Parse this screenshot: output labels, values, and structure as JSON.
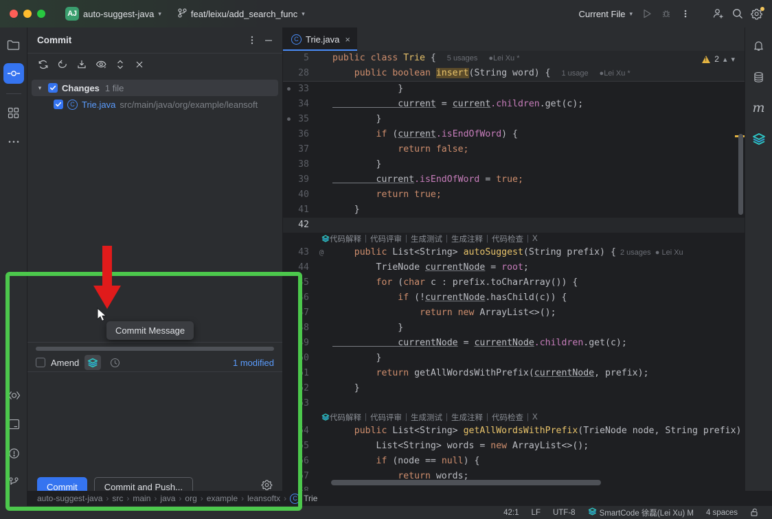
{
  "titlebar": {
    "project_badge": "AJ",
    "project_name": "auto-suggest-java",
    "branch": "feat/leixu/add_search_func",
    "run_config": "Current File",
    "icons": [
      "run-icon",
      "debug-icon",
      "more-actions-icon",
      "add-collaborator-icon",
      "search-everywhere-icon",
      "settings-icon"
    ]
  },
  "left_toolbar": {
    "items": [
      {
        "name": "project-tool-window",
        "icon": "folder-icon"
      },
      {
        "name": "commit-tool-window",
        "icon": "commit-icon",
        "active": true
      },
      {
        "name": "structure-tool-window",
        "icon": "structure-icon"
      },
      {
        "name": "more-tool-windows",
        "icon": "ellipsis-icon"
      }
    ],
    "bottom_items": [
      {
        "name": "code-with-me",
        "icon": "code-with-me-icon"
      },
      {
        "name": "terminal-tool-window",
        "icon": "terminal-icon"
      },
      {
        "name": "problems-tool-window",
        "icon": "problems-icon"
      },
      {
        "name": "version-control-tool-window",
        "icon": "git-branch-icon"
      }
    ]
  },
  "right_toolbar": {
    "items": [
      {
        "name": "notifications",
        "icon": "bell-icon"
      },
      {
        "name": "database-tool-window",
        "icon": "database-icon"
      },
      {
        "name": "maven-tool-window",
        "icon": "maven-m-icon"
      },
      {
        "name": "smartcode-tool-window",
        "icon": "smartcode-stack-icon"
      }
    ]
  },
  "commit_panel": {
    "title": "Commit",
    "header_icons": [
      "more-options-icon",
      "minimize-icon"
    ],
    "toolbar_icons": [
      "refresh-icon",
      "rollback-icon",
      "shelve-icon",
      "preview-diff-icon",
      "expand-collapse-icon",
      "close-icon"
    ],
    "changes": {
      "group_label": "Changes",
      "group_count": "1 file",
      "files": [
        {
          "name": "Trie.java",
          "path": "src/main/java/org/example/leansoft",
          "checked": true
        }
      ]
    },
    "amend_label": "Amend",
    "amend_checked": false,
    "modified_label": "1 modified",
    "message_value": "",
    "message_placeholder": "",
    "commit_button": "Commit",
    "commit_push_button": "Commit and Push...",
    "settings_icon": "gear-icon",
    "message_toolbar_icons": [
      "smartcode-commit-message-icon",
      "commit-history-icon"
    ],
    "tooltip": "Commit Message"
  },
  "editor": {
    "tab": {
      "label": "Trie.java",
      "icon": "java-class-icon",
      "close": "×"
    },
    "warnings": {
      "count": "2",
      "icon": "warning-icon"
    },
    "sticky_lines": [
      {
        "num": "5",
        "segments": [
          {
            "t": "kw",
            "s": "public "
          },
          {
            "t": "kw",
            "s": "class "
          },
          {
            "t": "fnd",
            "s": "Trie"
          },
          {
            "t": "pl",
            "s": " {"
          }
        ],
        "usages": "5 usages",
        "author": "Lei Xu *"
      },
      {
        "num": "28",
        "segments": [
          {
            "t": "kw",
            "s": "    public "
          },
          {
            "t": "kw",
            "s": "boolean "
          },
          {
            "t": "hl",
            "s": "insert"
          },
          {
            "t": "pl",
            "s": "(String word) {"
          }
        ],
        "usages": "1 usage",
        "author": "Lei Xu *"
      }
    ],
    "ai_hints": [
      "代码解释",
      "代码评审",
      "生成测试",
      "生成注释",
      "代码检查",
      "X"
    ],
    "lines": [
      {
        "num": "33",
        "bp": true,
        "segments": [
          {
            "t": "pl",
            "s": "            }"
          }
        ]
      },
      {
        "num": "34",
        "bp": false,
        "segments": [
          {
            "t": "und",
            "s": "            current"
          },
          {
            "t": "pl",
            "s": " = "
          },
          {
            "t": "und",
            "s": "current"
          },
          {
            "t": "fld",
            "s": ".children"
          },
          {
            "t": "pl",
            "s": ".get(c);"
          }
        ]
      },
      {
        "num": "35",
        "bp": true,
        "segments": [
          {
            "t": "pl",
            "s": "        }"
          }
        ]
      },
      {
        "num": "36",
        "bp": false,
        "segments": [
          {
            "t": "kw",
            "s": "        if "
          },
          {
            "t": "pl",
            "s": "("
          },
          {
            "t": "und",
            "s": "current"
          },
          {
            "t": "fld",
            "s": ".isEndOfWord"
          },
          {
            "t": "pl",
            "s": ") {"
          }
        ]
      },
      {
        "num": "37",
        "bp": false,
        "segments": [
          {
            "t": "kw",
            "s": "            return false;"
          }
        ]
      },
      {
        "num": "38",
        "bp": false,
        "segments": [
          {
            "t": "pl",
            "s": "        }"
          }
        ]
      },
      {
        "num": "39",
        "bp": false,
        "segments": [
          {
            "t": "und",
            "s": "        current"
          },
          {
            "t": "fld",
            "s": ".isEndOfWord"
          },
          {
            "t": "pl",
            "s": " = "
          },
          {
            "t": "kw",
            "s": "true;"
          }
        ]
      },
      {
        "num": "40",
        "bp": false,
        "segments": [
          {
            "t": "kw",
            "s": "        return true;"
          }
        ]
      },
      {
        "num": "41",
        "bp": false,
        "segments": [
          {
            "t": "pl",
            "s": "    }"
          }
        ]
      },
      {
        "num": "42",
        "bp": false,
        "current": true,
        "segments": []
      },
      {
        "num": "43",
        "bp": false,
        "fold": "@",
        "hints": true,
        "segments": [
          {
            "t": "kw",
            "s": "    public "
          },
          {
            "t": "pl",
            "s": "List<String> "
          },
          {
            "t": "fnd",
            "s": "autoSuggest"
          },
          {
            "t": "pl",
            "s": "(String prefix) {"
          }
        ],
        "usages": "2 usages",
        "author": "Lei Xu"
      },
      {
        "num": "44",
        "bp": false,
        "segments": [
          {
            "t": "pl",
            "s": "        TrieNode "
          },
          {
            "t": "und",
            "s": "currentNode"
          },
          {
            "t": "pl",
            "s": " = "
          },
          {
            "t": "fld",
            "s": "root"
          },
          {
            "t": "pl",
            "s": ";"
          }
        ]
      },
      {
        "num": "45",
        "bp": false,
        "segments": [
          {
            "t": "kw",
            "s": "        for "
          },
          {
            "t": "pl",
            "s": "("
          },
          {
            "t": "kw",
            "s": "char "
          },
          {
            "t": "pl",
            "s": "c : prefix.toCharArray()) {"
          }
        ]
      },
      {
        "num": "46",
        "bp": false,
        "segments": [
          {
            "t": "kw",
            "s": "            if "
          },
          {
            "t": "pl",
            "s": "(!"
          },
          {
            "t": "und",
            "s": "currentNode"
          },
          {
            "t": "pl",
            "s": ".hasChild(c)) {"
          }
        ]
      },
      {
        "num": "47",
        "bp": false,
        "segments": [
          {
            "t": "kw",
            "s": "                return new "
          },
          {
            "t": "pl",
            "s": "ArrayList<>();"
          }
        ]
      },
      {
        "num": "48",
        "bp": false,
        "segments": [
          {
            "t": "pl",
            "s": "            }"
          }
        ]
      },
      {
        "num": "49",
        "bp": false,
        "segments": [
          {
            "t": "und",
            "s": "            currentNode"
          },
          {
            "t": "pl",
            "s": " = "
          },
          {
            "t": "und",
            "s": "currentNode"
          },
          {
            "t": "fld",
            "s": ".children"
          },
          {
            "t": "pl",
            "s": ".get(c);"
          }
        ]
      },
      {
        "num": "50",
        "bp": false,
        "segments": [
          {
            "t": "pl",
            "s": "        }"
          }
        ]
      },
      {
        "num": "51",
        "bp": false,
        "segments": [
          {
            "t": "kw",
            "s": "        return "
          },
          {
            "t": "pl",
            "s": "getAllWordsWithPrefix("
          },
          {
            "t": "und",
            "s": "currentNode"
          },
          {
            "t": "pl",
            "s": ", prefix);"
          }
        ]
      },
      {
        "num": "52",
        "bp": false,
        "segments": [
          {
            "t": "pl",
            "s": "    }"
          }
        ]
      },
      {
        "num": "53",
        "bp": false,
        "segments": []
      },
      {
        "num": "54",
        "bp": false,
        "hints": true,
        "segments": [
          {
            "t": "kw",
            "s": "    public "
          },
          {
            "t": "pl",
            "s": "List<String> "
          },
          {
            "t": "fnd",
            "s": "getAllWordsWithPrefix"
          },
          {
            "t": "pl",
            "s": "(TrieNode node, String prefix)"
          }
        ]
      },
      {
        "num": "55",
        "bp": false,
        "segments": [
          {
            "t": "pl",
            "s": "        List<String> words = "
          },
          {
            "t": "kw",
            "s": "new "
          },
          {
            "t": "pl",
            "s": "ArrayList<>();"
          }
        ]
      },
      {
        "num": "56",
        "bp": false,
        "segments": [
          {
            "t": "kw",
            "s": "        if "
          },
          {
            "t": "pl",
            "s": "(node == "
          },
          {
            "t": "kw",
            "s": "null"
          },
          {
            "t": "pl",
            "s": ") {"
          }
        ]
      },
      {
        "num": "57",
        "bp": false,
        "segments": [
          {
            "t": "kw",
            "s": "            return "
          },
          {
            "t": "pl",
            "s": "words;"
          }
        ]
      },
      {
        "num": "58",
        "bp": false,
        "segments": []
      }
    ]
  },
  "breadcrumb": {
    "items": [
      "auto-suggest-java",
      "src",
      "main",
      "java",
      "org",
      "example",
      "leansoftx",
      "Trie"
    ],
    "separator": "›",
    "last_icon": "java-class-icon"
  },
  "statusbar": {
    "caret": "42:1",
    "line_separator": "LF",
    "encoding": "UTF-8",
    "smartcode": "SmartCode 徐磊(Lei Xu) M",
    "smartcode_icon": "smartcode-stack-icon",
    "indent": "4 spaces",
    "lock_icon": "unlocked-icon"
  },
  "annotations": {
    "highlight_color": "#4cc84c",
    "arrow_color": "#e01b1b"
  }
}
